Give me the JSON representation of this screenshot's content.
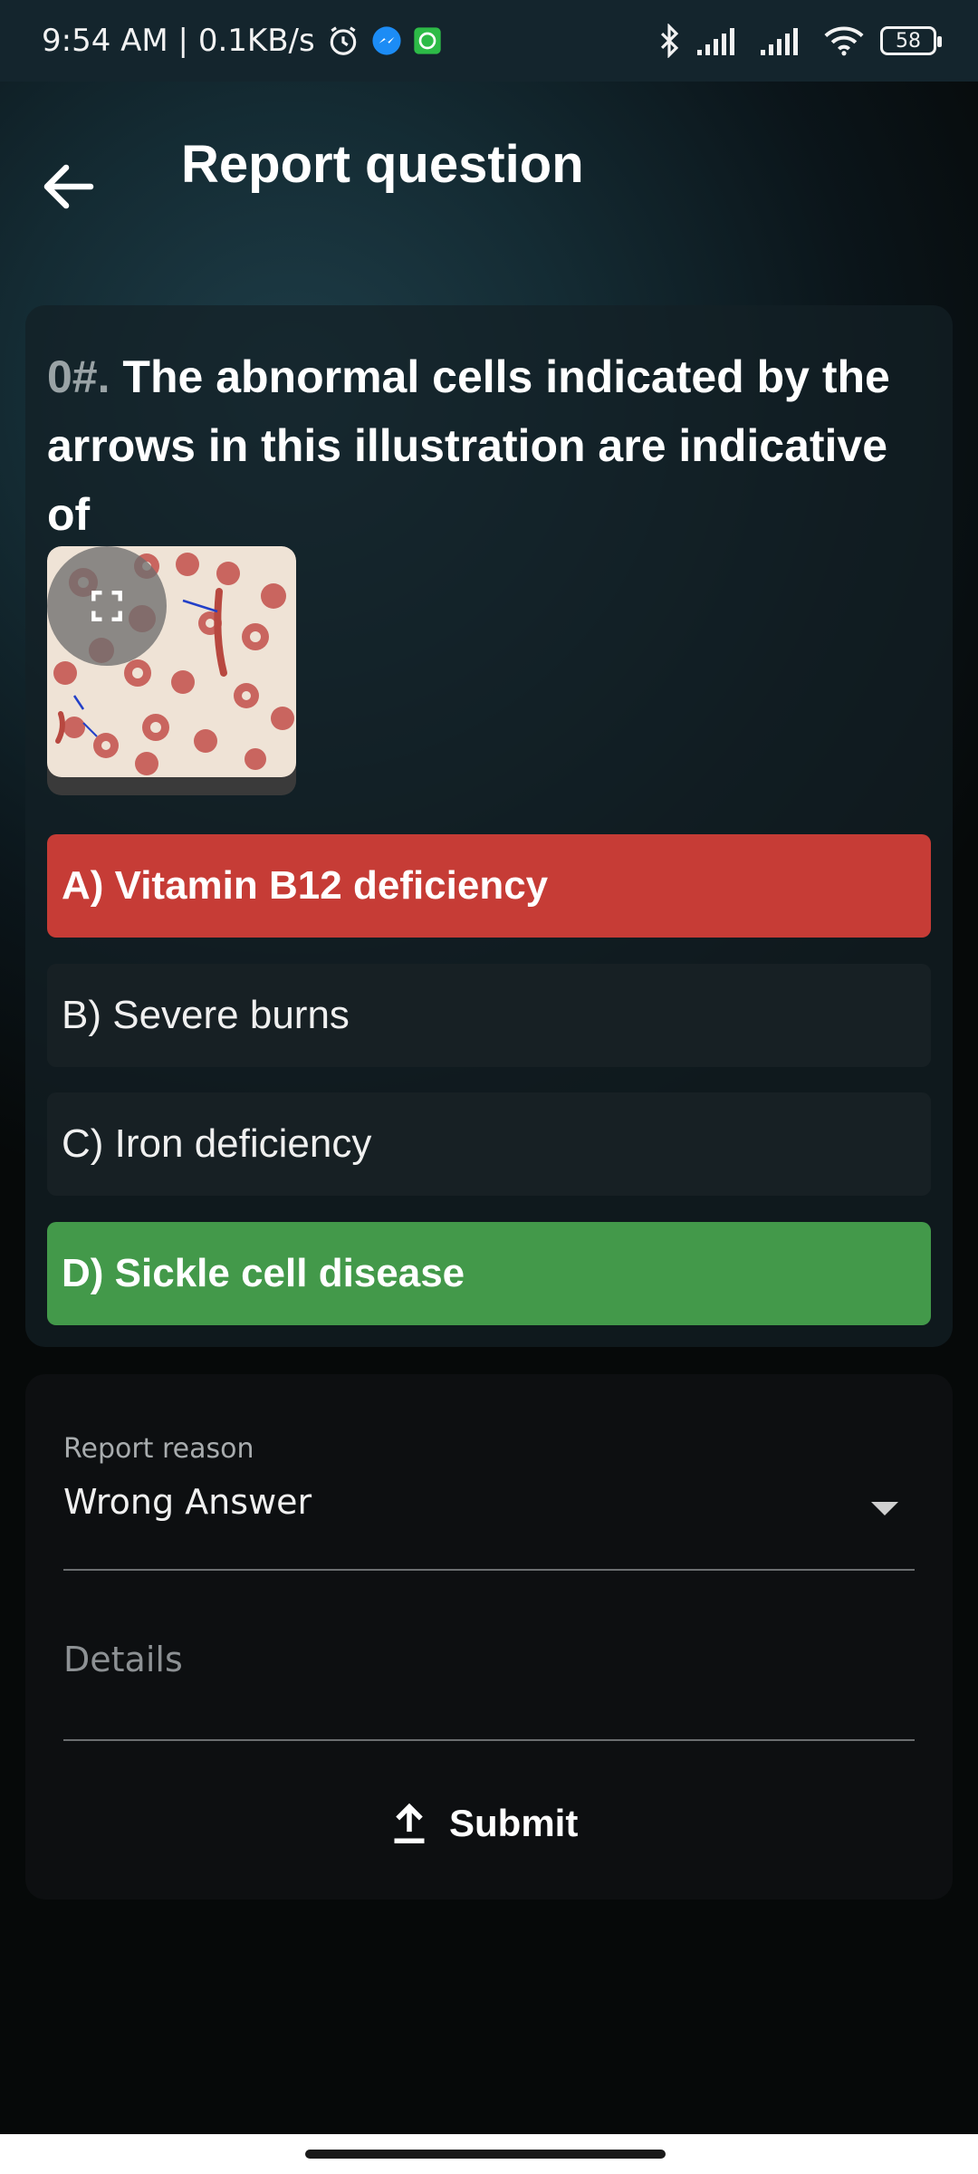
{
  "status_bar": {
    "time_speed": "9:54 AM | 0.1KB/s",
    "battery": "58"
  },
  "header": {
    "title": "Report question"
  },
  "question": {
    "number": "0#.",
    "text": " The abnormal cells indicated by the arrows in this illustration are indicative of"
  },
  "options": [
    {
      "label": "A) Vitamin B12 deficiency",
      "state": "wrong",
      "color": "#c63c36"
    },
    {
      "label": "B) Severe burns",
      "state": "neutral",
      "color": "#172024"
    },
    {
      "label": "C) Iron deficiency",
      "state": "neutral",
      "color": "#172024"
    },
    {
      "label": "D) Sickle cell disease",
      "state": "correct",
      "color": "#43994a"
    }
  ],
  "form": {
    "reason_label": "Report reason",
    "reason_value": "Wrong Answer",
    "details_placeholder": "Details",
    "submit_label": "Submit"
  },
  "icons": [
    "back-arrow-icon",
    "alarm-icon",
    "messenger-icon",
    "whatsapp-icon",
    "bluetooth-icon",
    "signal-icon",
    "wifi-icon",
    "battery-icon",
    "fullscreen-icon",
    "dropdown-arrow-icon",
    "upload-icon"
  ]
}
